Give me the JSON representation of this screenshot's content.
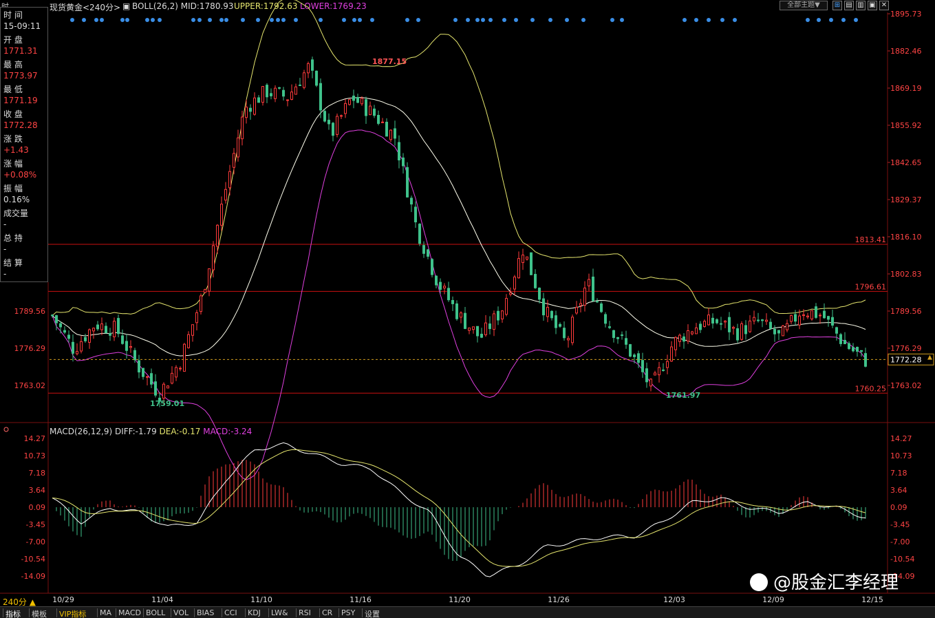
{
  "topbar": {
    "corner": "时",
    "symbol": "现货黄金<240分>",
    "boll": "BOLL(26,2) MID:1780.93",
    "upper": "UPPER:1792.63",
    "lower": "LOWER:1769.23",
    "theme": "全部主题▼"
  },
  "info": [
    {
      "label": "时 间",
      "value": "15-09:11",
      "color": "#dddddd"
    },
    {
      "label": "开 盘",
      "value": "1771.31",
      "color": "#ff4444"
    },
    {
      "label": "最 高",
      "value": "1773.97",
      "color": "#ff4444"
    },
    {
      "label": "最 低",
      "value": "1771.19",
      "color": "#ff4444"
    },
    {
      "label": "收 盘",
      "value": "1772.28",
      "color": "#ff4444"
    },
    {
      "label": "涨 跌",
      "value": "+1.43",
      "color": "#ff4444"
    },
    {
      "label": "涨 幅",
      "value": "+0.08%",
      "color": "#ff4444"
    },
    {
      "label": "振 幅",
      "value": "0.16%",
      "color": "#dddddd"
    },
    {
      "label": "成交量",
      "value": "-",
      "color": "#dddddd"
    },
    {
      "label": "总 持",
      "value": "-",
      "color": "#dddddd"
    },
    {
      "label": "结 算",
      "value": "-",
      "color": "#dddddd"
    }
  ],
  "price_axis": [
    "1895.73",
    "1882.46",
    "1869.19",
    "1855.92",
    "1842.65",
    "1829.37",
    "1816.10",
    "1802.83",
    "1789.56",
    "1776.29",
    "1763.02"
  ],
  "left_axis": [
    "1789.56",
    "1776.29",
    "1763.02"
  ],
  "hlines": [
    {
      "value": 1813.41,
      "label": "1813.41"
    },
    {
      "value": 1796.61,
      "label": "1796.61"
    },
    {
      "value": 1760.25,
      "label": "1760.25"
    }
  ],
  "price_marks": {
    "high": "1877.15",
    "low1": "1759.01",
    "low2": "1761.97"
  },
  "current": {
    "value": 1772.28,
    "label": "1772.28"
  },
  "macd": {
    "title": "MACD(26,12,9)",
    "diff": "DIFF:-1.79",
    "dea": "DEA:-0.17",
    "macd": "MACD:-3.24",
    "axis": [
      "14.27",
      "10.73",
      "7.18",
      "3.64",
      "0.09",
      "-3.45",
      "-7.00",
      "-10.54",
      "-14.09"
    ]
  },
  "dates": [
    "10/29",
    "11/04",
    "11/10",
    "11/16",
    "11/20",
    "11/26",
    "12/03",
    "12/09",
    "12/15"
  ],
  "watermark": "@股金汇李经理",
  "period": "240分 ▲",
  "bottom_tabs": [
    "指标",
    "模板",
    "VIP指标",
    "MA",
    "MACD",
    "BOLL",
    "VOL",
    "BIAS",
    "CCI",
    "KDJ",
    "LW&",
    "RSI",
    "CR",
    "PSY",
    "设置"
  ],
  "colors": {
    "up": "#ff3b3b",
    "down": "#3fc28b",
    "upper": "#e6e66e",
    "mid": "#ffffee",
    "lower": "#e040e0",
    "hline": "#cc1111"
  },
  "chart_data": {
    "type": "candlestick",
    "boll": {
      "mid": 1780.93,
      "upper": 1792.63,
      "lower": 1769.23
    },
    "keypoints": [
      1788,
      1776,
      1785,
      1783,
      1770,
      1760,
      1772,
      1795,
      1830,
      1862,
      1868,
      1866,
      1877,
      1852,
      1866,
      1860,
      1852,
      1820,
      1800,
      1788,
      1780,
      1790,
      1812,
      1790,
      1778,
      1800,
      1785,
      1775,
      1762,
      1778,
      1784,
      1786,
      1782,
      1786,
      1780,
      1790,
      1788,
      1778,
      1772
    ],
    "macd_keypoints": [
      2,
      -3,
      0,
      -1,
      -4,
      -3,
      6,
      12,
      13,
      11,
      9,
      8,
      3,
      -1,
      -10,
      -14,
      -12,
      -8,
      -7,
      -6,
      -6,
      -3,
      1,
      2,
      0,
      -1,
      1,
      0,
      -2
    ]
  }
}
